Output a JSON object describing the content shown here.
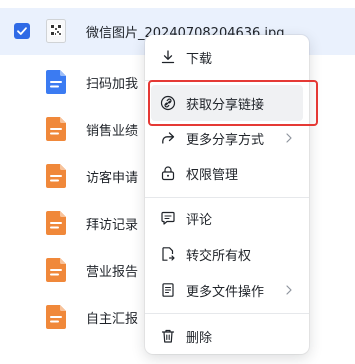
{
  "files": [
    {
      "name": "微信图片_20240708204636.jpg",
      "icon": "image-file-icon",
      "selected": true
    },
    {
      "name": "扫码加我",
      "icon": "doc-file-icon",
      "color": "#3b7bf2"
    },
    {
      "name": "销售业绩",
      "icon": "sheet-file-icon",
      "color": "#f0883a"
    },
    {
      "name": "访客申请",
      "icon": "sheet-file-icon",
      "color": "#f0883a"
    },
    {
      "name": "拜访记录",
      "icon": "sheet-file-icon",
      "color": "#f0883a"
    },
    {
      "name": "营业报告",
      "icon": "sheet-file-icon",
      "color": "#f0883a"
    },
    {
      "name": "自主汇报",
      "icon": "sheet-file-icon",
      "color": "#f0883a"
    }
  ],
  "menu": {
    "download": "下载",
    "get_share_link": "获取分享链接",
    "more_share": "更多分享方式",
    "permissions": "权限管理",
    "comment": "评论",
    "transfer_ownership": "转交所有权",
    "more_file_ops": "更多文件操作",
    "delete": "删除"
  },
  "colors": {
    "accent": "#2f6ae6",
    "highlight": "#e53935",
    "doc_blue": "#3b7bf2",
    "sheet_orange": "#f0883a"
  }
}
